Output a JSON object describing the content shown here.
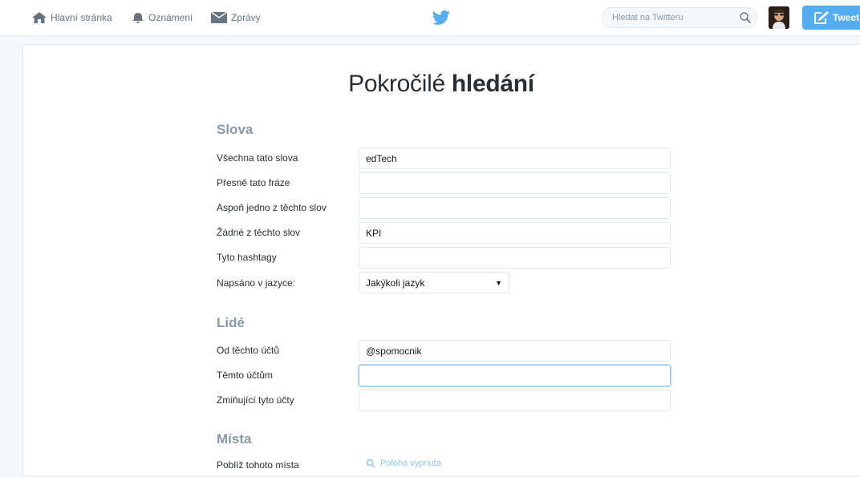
{
  "nav": {
    "home": "Hlavní stránka",
    "notifications": "Oznámení",
    "messages": "Zprávy"
  },
  "search": {
    "placeholder": "Hledat na Twitteru"
  },
  "tweet_button": "Tweet",
  "title": {
    "light": "Pokročilé ",
    "bold": "hledání"
  },
  "sections": {
    "words": "Slova",
    "people": "Lidé",
    "places": "Místa"
  },
  "fields": {
    "all_words": {
      "label": "Všechna tato slova",
      "value": "edTech"
    },
    "exact_phrase": {
      "label": "Přesně tato fráze",
      "value": ""
    },
    "any_words": {
      "label": "Aspoň jedno z těchto slov",
      "value": ""
    },
    "none_words": {
      "label": "Žádné z těchto slov",
      "value": "KPI"
    },
    "hashtags": {
      "label": "Tyto hashtagy",
      "value": ""
    },
    "language": {
      "label": "Napsáno v jazyce:",
      "value": "Jakýkoli jazyk"
    },
    "from_accounts": {
      "label": "Od těchto účtů",
      "value": "@spomocnik"
    },
    "to_accounts": {
      "label": "Těmto účtům",
      "value": ""
    },
    "mentioning": {
      "label": "Zmiňující tyto účty",
      "value": ""
    },
    "near_place": {
      "label": "Poblíž tohoto místa",
      "value": "Poloha vypnuta"
    }
  },
  "colors": {
    "accent": "#55acee",
    "section": "#8899a6",
    "border": "#e1e8ed",
    "focus": "#8ec4ef"
  },
  "icons": [
    "home-icon",
    "bell-icon",
    "envelope-icon",
    "twitter-bird-icon",
    "search-icon",
    "compose-icon",
    "location-pin-icon"
  ]
}
